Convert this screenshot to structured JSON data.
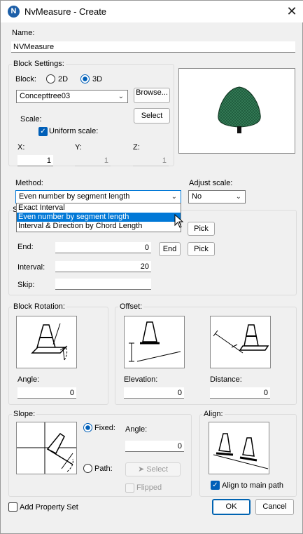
{
  "window": {
    "app_icon_letter": "N",
    "title": "NvMeasure - Create",
    "close_glyph": "✕"
  },
  "name": {
    "label": "Name:",
    "value": "NVMeasure"
  },
  "block_settings": {
    "legend": "Block Settings:",
    "block_label": "Block:",
    "radio_2d": "2D",
    "radio_3d": "3D",
    "block_value": "Concepttree03",
    "browse_label": "Browse...",
    "select_label": "Select",
    "scale_label": "Scale:",
    "uniform_scale_label": "Uniform scale:",
    "x_label": "X:",
    "x_value": "1",
    "y_label": "Y:",
    "y_value": "1",
    "z_label": "Z:",
    "z_value": "1"
  },
  "method": {
    "label": "Method:",
    "value": "Even number by segment length",
    "options": [
      "Exact Interval",
      "Even number by segment length",
      "Interval & Direction by Chord Length"
    ],
    "selected_index": 1
  },
  "adjust_scale": {
    "label": "Adjust scale:",
    "value": "No"
  },
  "start_group_label_initial": "S",
  "end": {
    "label": "End:",
    "value": "0",
    "end_button": "End",
    "pick_button": "Pick"
  },
  "start_pick_button": "Pick",
  "interval": {
    "label": "Interval:",
    "value": "20"
  },
  "skip": {
    "label": "Skip:",
    "value": ""
  },
  "block_rotation": {
    "legend": "Block Rotation:",
    "angle_label": "Angle:",
    "angle_value": "0"
  },
  "offset": {
    "legend": "Offset:",
    "elevation_label": "Elevation:",
    "elevation_value": "0",
    "distance_label": "Distance:",
    "distance_value": "0"
  },
  "slope": {
    "legend": "Slope:",
    "fixed_label": "Fixed:",
    "angle_label": "Angle:",
    "angle_value": "0",
    "path_label": "Path:",
    "select_label": "Select",
    "flipped_label": "Flipped"
  },
  "align": {
    "legend": "Align:",
    "align_to_path_label": "Align to main path"
  },
  "add_property_set_label": "Add Property Set",
  "ok_label": "OK",
  "cancel_label": "Cancel",
  "colors": {
    "accent": "#005fb8",
    "selection": "#0078d7",
    "tree": "#1e5a3c"
  }
}
